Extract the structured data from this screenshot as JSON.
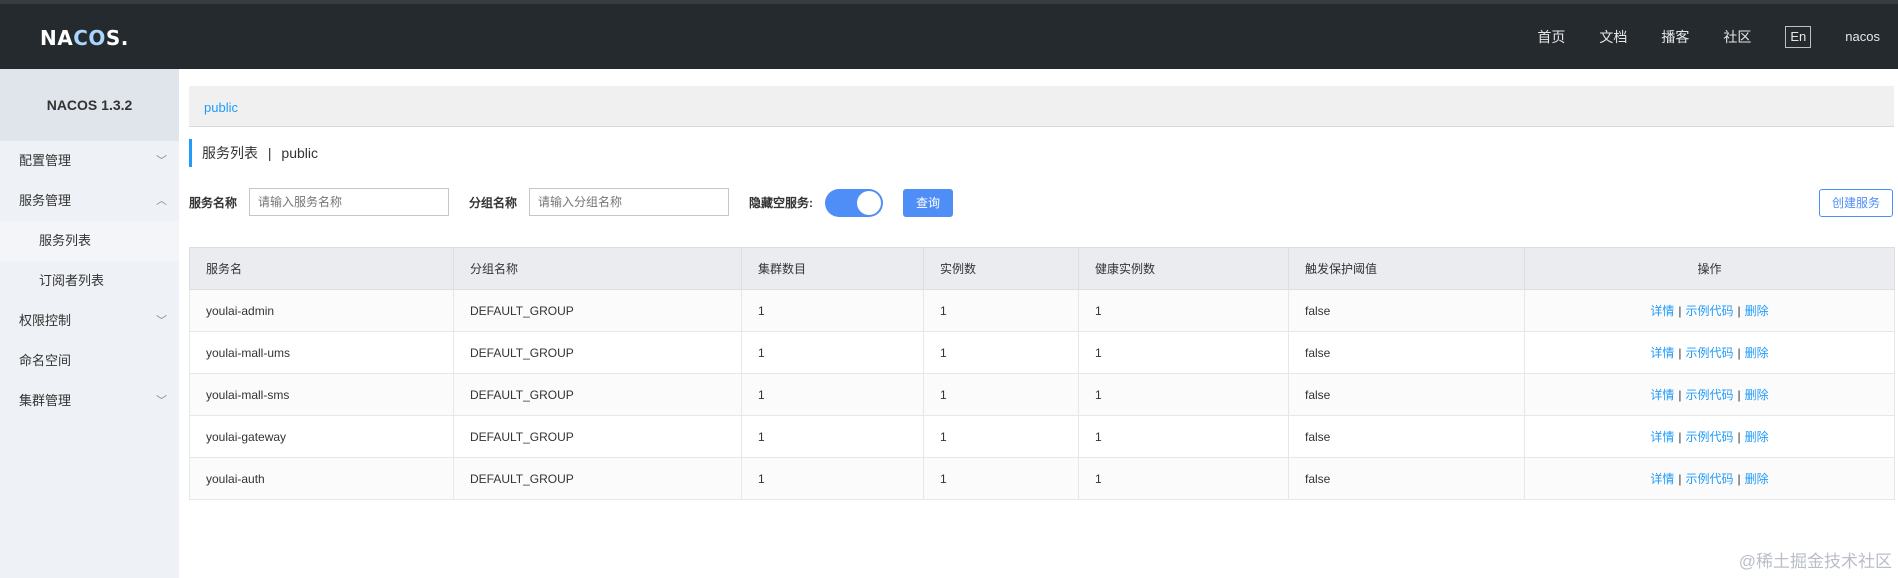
{
  "header": {
    "logo": {
      "left": "NA",
      "mid": "CO",
      "right": "S."
    },
    "nav": [
      "首页",
      "文档",
      "播客",
      "社区"
    ],
    "lang": "En",
    "user": "nacos"
  },
  "sidebar": {
    "version": "NACOS 1.3.2",
    "items": [
      {
        "label": "配置管理",
        "chevron": "﹀"
      },
      {
        "label": "服务管理",
        "chevron": "︿"
      },
      {
        "label": "服务列表",
        "chevron": ""
      },
      {
        "label": "订阅者列表",
        "chevron": ""
      },
      {
        "label": "权限控制",
        "chevron": "﹀"
      },
      {
        "label": "命名空间",
        "chevron": ""
      },
      {
        "label": "集群管理",
        "chevron": "﹀"
      }
    ]
  },
  "main": {
    "namespace_tab": "public",
    "title": "服务列表",
    "title_sep": "|",
    "title_ns": "public",
    "filters": {
      "service_label": "服务名称",
      "service_placeholder": "请输入服务名称",
      "group_label": "分组名称",
      "group_placeholder": "请输入分组名称",
      "hide_empty_label": "隐藏空服务:",
      "hide_empty_on": true,
      "query_button": "查询",
      "create_button": "创建服务"
    },
    "table": {
      "headers": [
        "服务名",
        "分组名称",
        "集群数目",
        "实例数",
        "健康实例数",
        "触发保护阈值",
        "操作"
      ],
      "rows": [
        [
          "youlai-admin",
          "DEFAULT_GROUP",
          "1",
          "1",
          "1",
          "false"
        ],
        [
          "youlai-mall-ums",
          "DEFAULT_GROUP",
          "1",
          "1",
          "1",
          "false"
        ],
        [
          "youlai-mall-sms",
          "DEFAULT_GROUP",
          "1",
          "1",
          "1",
          "false"
        ],
        [
          "youlai-gateway",
          "DEFAULT_GROUP",
          "1",
          "1",
          "1",
          "false"
        ],
        [
          "youlai-auth",
          "DEFAULT_GROUP",
          "1",
          "1",
          "1",
          "false"
        ]
      ],
      "actions": {
        "detail": "详情",
        "sample": "示例代码",
        "delete": "删除",
        "sep": "|"
      }
    }
  },
  "watermark": "@稀土掘金技术社区",
  "colors": {
    "accent": "#209bfa",
    "header_bg": "#252a2f",
    "toggle": "#4f8ef7"
  }
}
